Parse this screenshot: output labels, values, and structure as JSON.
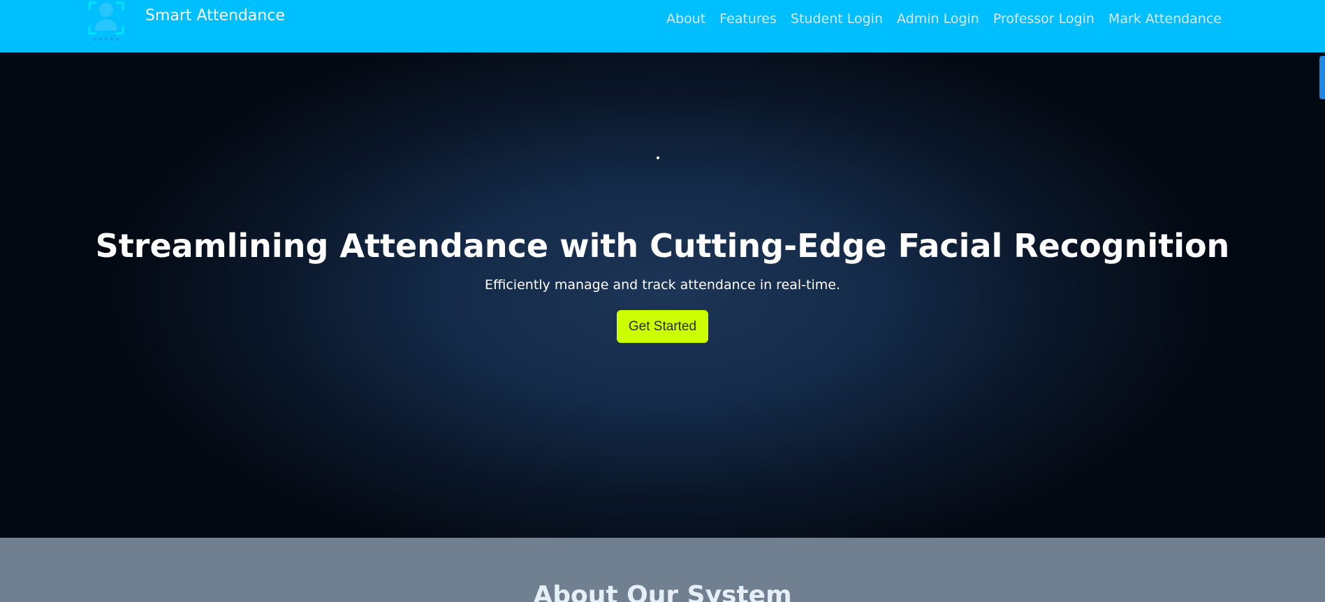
{
  "navbar": {
    "brand": "Smart Attendance",
    "links": [
      "About",
      "Features",
      "Student Login",
      "Admin Login",
      "Professor Login",
      "Mark Attendance"
    ]
  },
  "hero": {
    "title": "Streamlining Attendance with Cutting-Edge Facial Recognition",
    "subtitle": "Efficiently manage and track attendance in real-time.",
    "cta_label": "Get Started"
  },
  "about": {
    "title": "About Our System"
  },
  "colors": {
    "navbar_bg": "#00bfff",
    "cta_bg": "#ccff00",
    "about_bg": "#708090",
    "hero_center": "#1d3557",
    "hero_edge": "#030912"
  },
  "icons": {
    "logo": "face-recognition-logo-icon"
  }
}
